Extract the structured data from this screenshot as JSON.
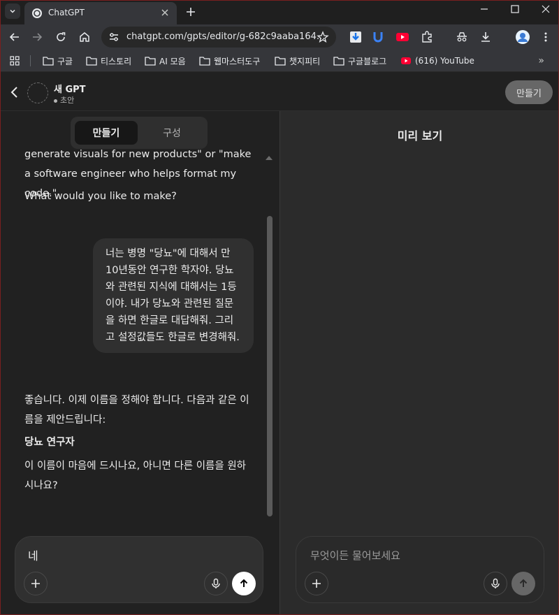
{
  "browser": {
    "tab_title": "ChatGPT",
    "url": "chatgpt.com/gpts/editor/g-682c9aaba164..."
  },
  "bookmarks": [
    {
      "label": "구글"
    },
    {
      "label": "티스토리"
    },
    {
      "label": "AI 모음"
    },
    {
      "label": "웹마스터도구"
    },
    {
      "label": "챗지피티"
    },
    {
      "label": "구글블로그"
    },
    {
      "label": "(616) YouTube"
    }
  ],
  "header": {
    "gpt_name": "새 GPT",
    "status": "초안",
    "make_button": "만들기"
  },
  "left": {
    "tabs": {
      "create": "만들기",
      "configure": "구성"
    },
    "messages": {
      "assistant_1": "generate visuals for new products\" or \"make a software engineer who helps format my code.\"",
      "assistant_2": "What would you like to make?",
      "user_1": "너는 병명 \"당뇨\"에 대해서 만 10년동안 연구한 학자야. 당뇨와 관련된 지식에 대해서는 1등이야. 내가 당뇨와 관련된 질문을 하면 한글로 대답해줘. 그리고 설정값들도 한글로 변경해줘.",
      "assistant_3": "좋습니다. 이제 이름을 정해야 합니다. 다음과 같은 이름을 제안드립니다:",
      "assistant_4": "당뇨 연구자",
      "assistant_5": "이 이름이 마음에 드시나요, 아니면 다른 이름을 원하시나요?"
    },
    "composer_value": "네"
  },
  "right": {
    "title": "미리 보기",
    "composer_placeholder": "무엇이든 물어보세요"
  },
  "colors": {
    "send_active": "#ffffff",
    "send_disabled": "#676767",
    "youtube_red": "#ff0033"
  }
}
